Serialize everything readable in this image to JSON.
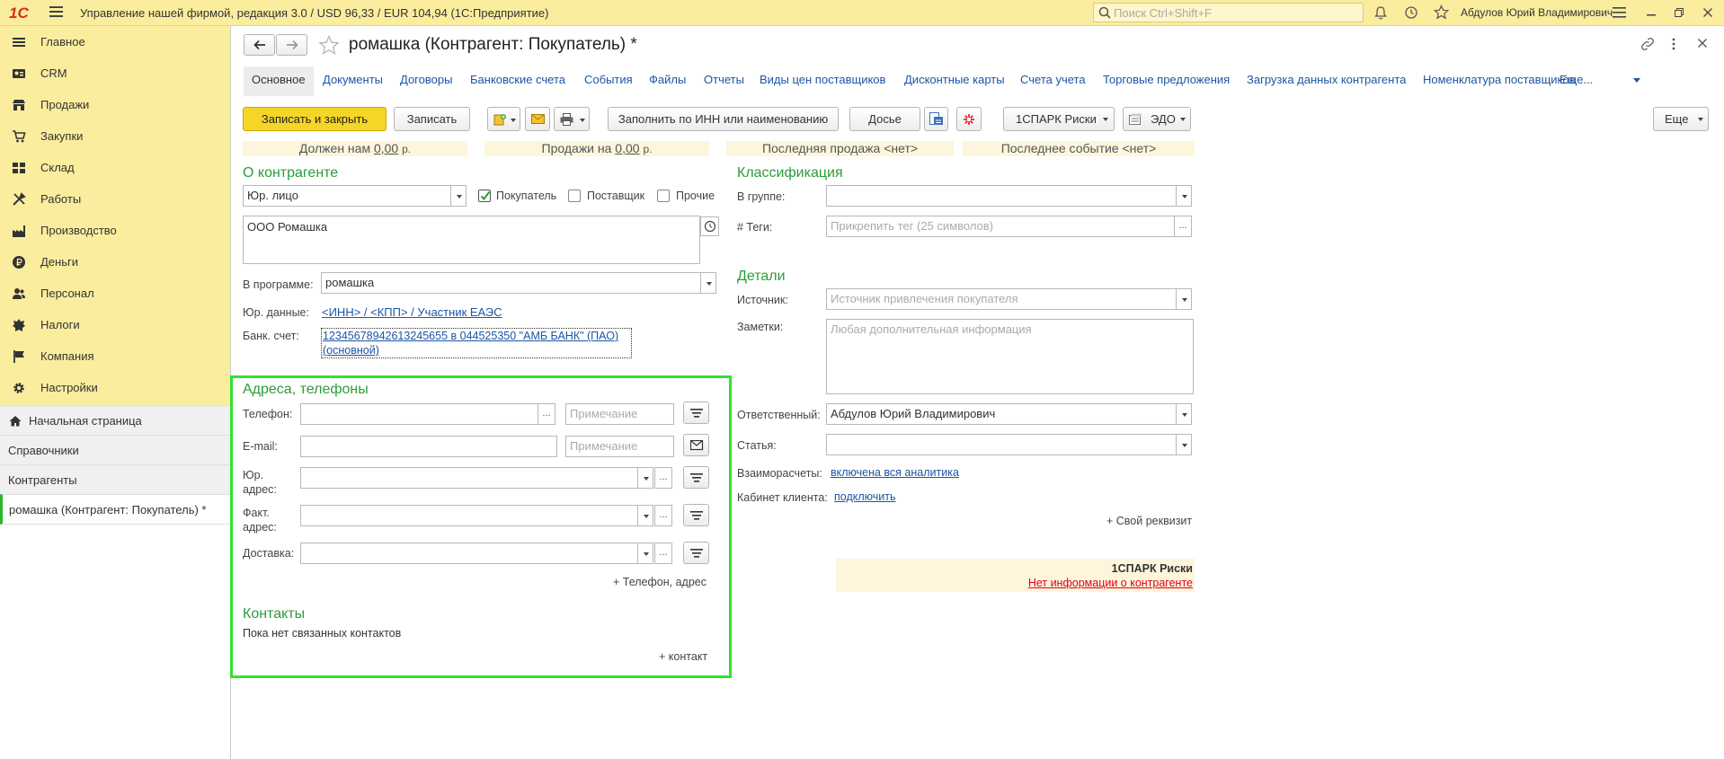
{
  "topbar": {
    "logo": "1С",
    "title": "Управление нашей фирмой, редакция 3.0 / USD 96,33 / EUR 104,94  (1С:Предприятие)",
    "search_placeholder": "Поиск Ctrl+Shift+F",
    "user": "Абдулов Юрий Владимирович"
  },
  "sidebar": {
    "sections": [
      {
        "label": "Главное",
        "icon": "menu-lines-icon"
      },
      {
        "label": "CRM",
        "icon": "crm-icon"
      },
      {
        "label": "Продажи",
        "icon": "shop-icon"
      },
      {
        "label": "Закупки",
        "icon": "cart-icon"
      },
      {
        "label": "Склад",
        "icon": "warehouse-grid-icon"
      },
      {
        "label": "Работы",
        "icon": "tools-icon"
      },
      {
        "label": "Производство",
        "icon": "factory-icon"
      },
      {
        "label": "Деньги",
        "icon": "ruble-coin-icon"
      },
      {
        "label": "Персонал",
        "icon": "people-icon"
      },
      {
        "label": "Налоги",
        "icon": "emblem-icon"
      },
      {
        "label": "Компания",
        "icon": "flag-icon"
      },
      {
        "label": "Настройки",
        "icon": "gear-icon"
      }
    ],
    "nav": [
      {
        "label": "Начальная страница",
        "icon": "home-icon"
      },
      {
        "label": "Справочники"
      },
      {
        "label": "Контрагенты"
      },
      {
        "label": "ромашка (Контрагент: Покупатель) *"
      }
    ]
  },
  "form": {
    "title": "ромашка (Контрагент: Покупатель) *",
    "tabs": [
      "Основное",
      "Документы",
      "Договоры",
      "Банковские счета",
      "События",
      "Файлы",
      "Отчеты",
      "Виды цен поставщиков",
      "Дисконтные карты",
      "Счета учета",
      "Торговые предложения",
      "Загрузка данных контрагента",
      "Номенклатура поставщиков",
      "Еще..."
    ],
    "toolbar": {
      "save_close": "Записать и закрыть",
      "save": "Записать",
      "fill_inn": "Заполнить по ИНН или наименованию",
      "dossier": "Досье",
      "spark": "1СПАРК Риски",
      "edo": "ЭДО",
      "more": "Еще"
    },
    "info": {
      "owe_prefix": "Должен нам",
      "owe_value": "0,00",
      "owe_unit": "р.",
      "sales_prefix": "Продажи на",
      "sales_value": "0,00",
      "sales_unit": "р.",
      "last_sale": "Последняя продажа <нет>",
      "last_event": "Последнее событие <нет>"
    },
    "about": {
      "header": "О контрагенте",
      "type": "Юр. лицо",
      "buyer_label": "Покупатель",
      "buyer_checked": true,
      "supplier_label": "Поставщик",
      "supplier_checked": false,
      "other_label": "Прочие",
      "other_checked": false,
      "full_name": "ООО Ромашка",
      "in_program_label": "В программе:",
      "in_program_value": "ромашка",
      "legal_label": "Юр. данные:",
      "legal_link": "<ИНН> / <КПП> / Участник ЕАЭС",
      "bank_label": "Банк. счет:",
      "bank_line1": "12345678942613245655  в 044525350 \"АМБ БАНК\" (ПАО)",
      "bank_line2": "(основной)"
    },
    "addresses": {
      "header": "Адреса, телефоны",
      "phone_label": "Телефон:",
      "email_label": "E-mail:",
      "note_placeholder": "Примечание",
      "legal_addr_label1": "Юр.",
      "legal_addr_label2": "адрес:",
      "fact_addr_label1": "Факт.",
      "fact_addr_label2": "адрес:",
      "delivery_label": "Доставка:",
      "add_phone_address": "+ Телефон, адрес"
    },
    "contacts": {
      "header": "Контакты",
      "empty_text": "Пока нет связанных контактов",
      "add_contact": "+ контакт"
    },
    "classification": {
      "header": "Классификация",
      "group_label": "В группе:",
      "tags_label": "#  Теги:",
      "tags_placeholder": "Прикрепить тег (25 символов)"
    },
    "details": {
      "header": "Детали",
      "source_label": "Источник:",
      "source_placeholder": "Источник привлечения покупателя",
      "notes_label": "Заметки:",
      "notes_placeholder": "Любая дополнительная информация",
      "responsible_label": "Ответственный:",
      "responsible_value": "Абдулов Юрий Владимирович",
      "article_label": "Статья:",
      "settlements_label": "Взаиморасчеты:",
      "settlements_link": "включена вся аналитика",
      "cabinet_label": "Кабинет клиента:",
      "cabinet_link": "подключить",
      "own_attr": "+ Свой реквизит"
    },
    "spark": {
      "title": "1СПАРК Риски",
      "no_info": "Нет информации о контрагенте"
    }
  },
  "colors": {
    "topbar_bg": "#fbed9e",
    "accent_green": "#2d9b38",
    "link_blue": "#1c55a6",
    "primary_button": "#f5d627",
    "highlight_border": "#31e231",
    "error_red": "#e0001b"
  }
}
